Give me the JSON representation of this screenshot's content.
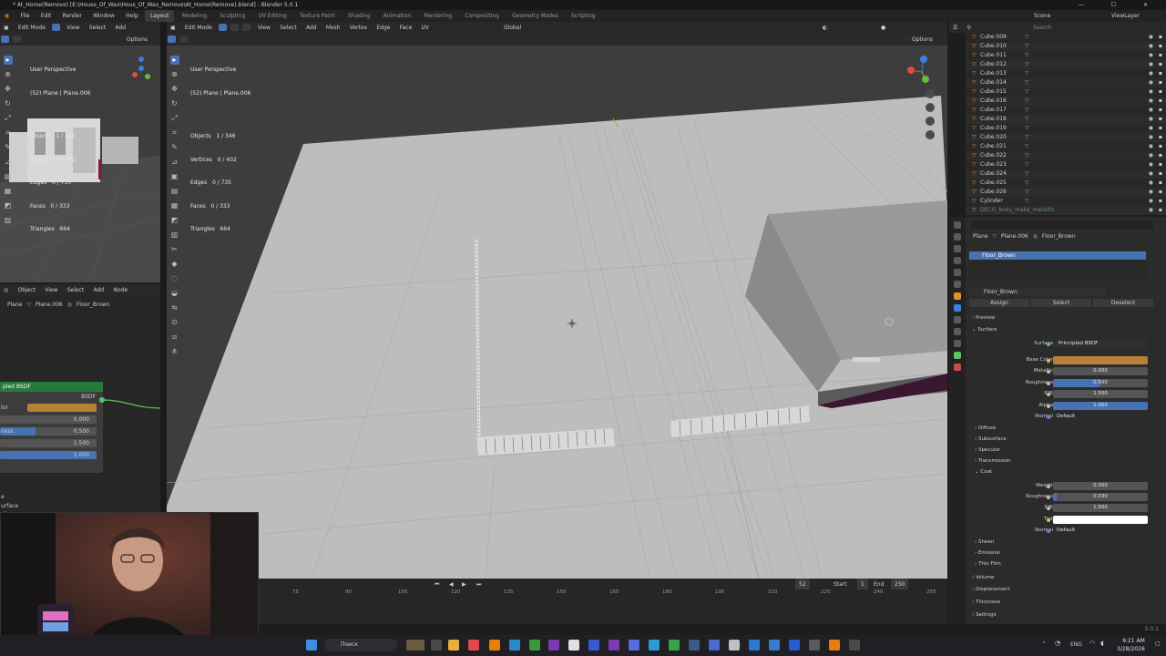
{
  "window": {
    "title": "* At_Home(Remove) [E:\\House_Of_Wax\\Hous_Of_Wax_Remove\\At_Home(Remove).blend] - Blender 5.0.1",
    "controls": [
      "—",
      "☐",
      "✕"
    ]
  },
  "menu": [
    "File",
    "Edit",
    "Render",
    "Window",
    "Help"
  ],
  "workspaces": [
    "Layout",
    "Modeling",
    "Sculpting",
    "UV Editing",
    "Texture Paint",
    "Shading",
    "Animation",
    "Rendering",
    "Compositing",
    "Geometry Nodes",
    "Scripting"
  ],
  "active_workspace": "Layout",
  "scene": {
    "name": "Scene",
    "view_layer": "ViewLayer"
  },
  "left_view": {
    "mode": "Edit Mode",
    "menus": [
      "View",
      "Select",
      "Add"
    ],
    "options": "Options",
    "info": [
      "User Perspective",
      "(52) Plane | Plane.006",
      "",
      "Objects   1 / 346",
      "Vertices   0 / 402",
      "Edges   0 / 735",
      "Faces   0 / 333",
      "Triangles   664"
    ]
  },
  "main_view": {
    "mode": "Edit Mode",
    "menus": [
      "View",
      "Select",
      "Add",
      "Mesh",
      "Vertex",
      "Edge",
      "Face",
      "UV"
    ],
    "orientation": "Global",
    "options": "Options",
    "info": [
      "User Perspective",
      "(52) Plane | Plane.006",
      "",
      "Objects   1 / 346",
      "Vertices   0 / 402",
      "Edges   0 / 735",
      "Faces   0 / 333",
      "Triangles   664"
    ]
  },
  "node_editor": {
    "menus": [
      "Object",
      "View",
      "Select",
      "Add",
      "Node"
    ],
    "breadcrumb": [
      "Plane",
      "Plane.006",
      "Floor_Brown"
    ],
    "node_title": "pled BSDF",
    "node_output": "BSDF",
    "rows": [
      {
        "label": "lor",
        "value": ""
      },
      {
        "label": "lic",
        "value": "0.000"
      },
      {
        "label": "ness",
        "value": "0.500"
      },
      {
        "label": "",
        "value": "1.500"
      },
      {
        "label": "",
        "value": "1.000"
      },
      {
        "label": "e",
        "value": ""
      },
      {
        "label": "urface",
        "value": ""
      },
      {
        "label": "ular",
        "value": ""
      }
    ]
  },
  "outliner": {
    "search_placeholder": "Search",
    "items": [
      "Cube.009",
      "Cube.010",
      "Cube.011",
      "Cube.012",
      "Cube.013",
      "Cube.014",
      "Cube.015",
      "Cube.016",
      "Cube.017",
      "Cube.018",
      "Cube.019",
      "Cube.020",
      "Cube.021",
      "Cube.022",
      "Cube.023",
      "Cube.024",
      "Cube.025",
      "Cube.026",
      "Cylinder",
      "DECO_body_make_metallic"
    ]
  },
  "properties": {
    "breadcrumb": [
      "Plane",
      "Plane.006",
      "Floor_Brown"
    ],
    "slot": "Floor_Brown",
    "material_name": "Floor_Brown",
    "assign": "Assign",
    "select": "Select",
    "deselect": "Deselect",
    "sections": {
      "preview": "Preview",
      "surface": "Surface",
      "diffuse": "Diffuse",
      "subsurface": "Subsurface",
      "specular": "Specular",
      "transmission": "Transmission",
      "coat": "Coat",
      "sheen": "Sheen",
      "emission": "Emission",
      "thin_film": "Thin Film",
      "volume": "Volume",
      "displacement": "Displacement",
      "thickness": "Thickness",
      "settings": "Settings"
    },
    "surface_fields": [
      {
        "label": "Surface",
        "value": "Principled BSDF"
      },
      {
        "label": "Base Color",
        "value": ""
      },
      {
        "label": "Metallic",
        "value": "0.000"
      },
      {
        "label": "Roughness",
        "value": "0.500"
      },
      {
        "label": "IOR",
        "value": "1.500"
      },
      {
        "label": "Alpha",
        "value": "1.000"
      },
      {
        "label": "Normal",
        "value": "Default"
      }
    ],
    "coat_fields": [
      {
        "label": "Weight",
        "value": "0.000"
      },
      {
        "label": "Roughness",
        "value": "0.030"
      },
      {
        "label": "IOR",
        "value": "1.500"
      },
      {
        "label": "Tint",
        "value": ""
      },
      {
        "label": "Normal",
        "value": "Default"
      }
    ],
    "colors": {
      "base_color": "#b8813a",
      "tint": "#ffffff",
      "bar": "#4772b3",
      "active_row": "#4772b3"
    }
  },
  "timeline": {
    "frame": "52",
    "start_label": "Start",
    "start": "1",
    "end_label": "End",
    "end": "250",
    "ticks": [
      "75",
      "90",
      "105",
      "120",
      "135",
      "150",
      "165",
      "180",
      "195",
      "210",
      "225",
      "240",
      "255"
    ]
  },
  "taskbar": {
    "search": "Поиск",
    "lang": "ENG",
    "time": "9:21 AM",
    "date": "3/28/2026"
  },
  "status": "5.0.1"
}
